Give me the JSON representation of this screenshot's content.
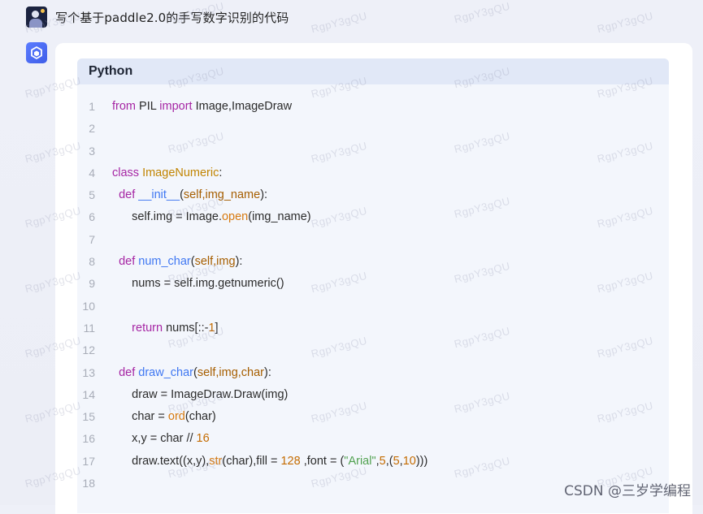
{
  "chat": {
    "user_question": "写个基于paddle2.0的手写数字识别的代码"
  },
  "code_block": {
    "language": "Python",
    "lines": [
      {
        "n": "1",
        "tokens": [
          {
            "t": "from",
            "c": "kw"
          },
          {
            "t": " PIL ",
            "c": "p"
          },
          {
            "t": "import",
            "c": "kw"
          },
          {
            "t": " Image,ImageDraw",
            "c": "p"
          }
        ]
      },
      {
        "n": "2",
        "tokens": []
      },
      {
        "n": "3",
        "tokens": []
      },
      {
        "n": "4",
        "tokens": [
          {
            "t": "class",
            "c": "kw"
          },
          {
            "t": " ",
            "c": "p"
          },
          {
            "t": "ImageNumeric",
            "c": "cls"
          },
          {
            "t": ":",
            "c": "p"
          }
        ]
      },
      {
        "n": "5",
        "tokens": [
          {
            "t": "  ",
            "c": "p"
          },
          {
            "t": "def",
            "c": "kw"
          },
          {
            "t": " ",
            "c": "p"
          },
          {
            "t": "__init__",
            "c": "fn"
          },
          {
            "t": "(",
            "c": "p"
          },
          {
            "t": "self,img_name",
            "c": "self"
          },
          {
            "t": "):",
            "c": "p"
          }
        ]
      },
      {
        "n": "6",
        "tokens": [
          {
            "t": "      self.img = Image.",
            "c": "p"
          },
          {
            "t": "open",
            "c": "bi"
          },
          {
            "t": "(img_name)",
            "c": "p"
          }
        ]
      },
      {
        "n": "7",
        "tokens": []
      },
      {
        "n": "8",
        "tokens": [
          {
            "t": "  ",
            "c": "p"
          },
          {
            "t": "def",
            "c": "kw"
          },
          {
            "t": " ",
            "c": "p"
          },
          {
            "t": "num_char",
            "c": "fn"
          },
          {
            "t": "(",
            "c": "p"
          },
          {
            "t": "self,img",
            "c": "self"
          },
          {
            "t": "):",
            "c": "p"
          }
        ]
      },
      {
        "n": "9",
        "tokens": [
          {
            "t": "      nums = self.img.getnumeric()",
            "c": "p"
          }
        ]
      },
      {
        "n": "10",
        "tokens": []
      },
      {
        "n": "11",
        "tokens": [
          {
            "t": "      ",
            "c": "p"
          },
          {
            "t": "return",
            "c": "kw"
          },
          {
            "t": " nums[::-",
            "c": "p"
          },
          {
            "t": "1",
            "c": "num"
          },
          {
            "t": "]",
            "c": "p"
          }
        ]
      },
      {
        "n": "12",
        "tokens": []
      },
      {
        "n": "13",
        "tokens": [
          {
            "t": "  ",
            "c": "p"
          },
          {
            "t": "def",
            "c": "kw"
          },
          {
            "t": " ",
            "c": "p"
          },
          {
            "t": "draw_char",
            "c": "fn"
          },
          {
            "t": "(",
            "c": "p"
          },
          {
            "t": "self,img,char",
            "c": "self"
          },
          {
            "t": "):",
            "c": "p"
          }
        ]
      },
      {
        "n": "14",
        "tokens": [
          {
            "t": "      draw = ImageDraw.Draw(img)",
            "c": "p"
          }
        ]
      },
      {
        "n": "15",
        "tokens": [
          {
            "t": "      char = ",
            "c": "p"
          },
          {
            "t": "ord",
            "c": "bi"
          },
          {
            "t": "(char)",
            "c": "p"
          }
        ]
      },
      {
        "n": "16",
        "tokens": [
          {
            "t": "      x,y = char // ",
            "c": "p"
          },
          {
            "t": "16",
            "c": "num"
          }
        ]
      },
      {
        "n": "17",
        "tokens": [
          {
            "t": "      draw.text((x,y),",
            "c": "p"
          },
          {
            "t": "str",
            "c": "bi"
          },
          {
            "t": "(char),fill = ",
            "c": "p"
          },
          {
            "t": "128",
            "c": "num"
          },
          {
            "t": " ,font = (",
            "c": "p"
          },
          {
            "t": "\"Arial\"",
            "c": "str"
          },
          {
            "t": ",",
            "c": "p"
          },
          {
            "t": "5",
            "c": "num"
          },
          {
            "t": ",(",
            "c": "p"
          },
          {
            "t": "5",
            "c": "num"
          },
          {
            "t": ",",
            "c": "p"
          },
          {
            "t": "10",
            "c": "num"
          },
          {
            "t": ")))",
            "c": "p"
          }
        ]
      },
      {
        "n": "18",
        "tokens": []
      }
    ]
  },
  "watermark_text": "RgpY3gQU",
  "site_watermark": "CSDN @三岁学编程",
  "icons": {
    "user_avatar": "user-avatar-icon",
    "bot_avatar": "cube-logo-icon"
  }
}
